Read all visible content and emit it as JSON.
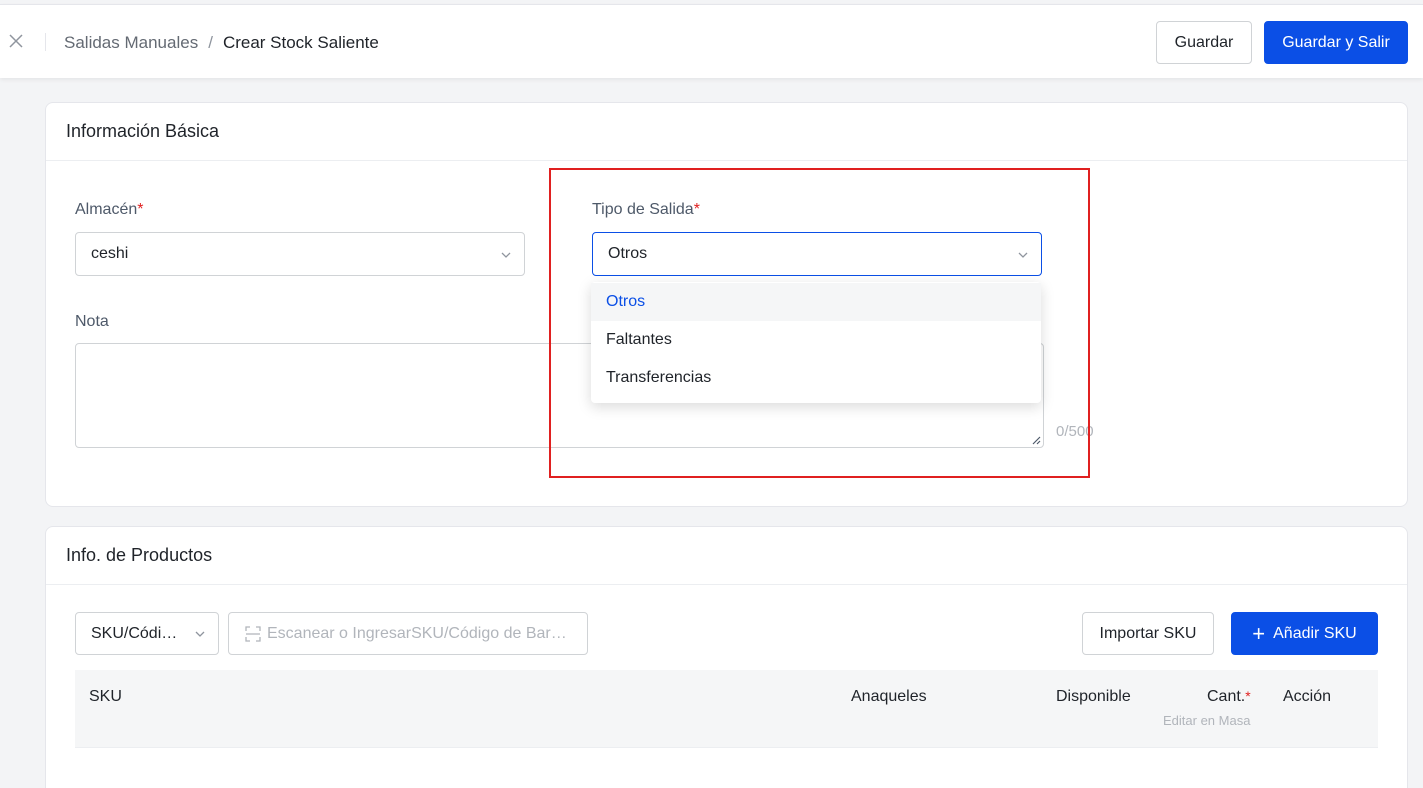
{
  "header": {
    "breadcrumb": {
      "parent": "Salidas Manuales",
      "separator": "/",
      "current": "Crear Stock Saliente"
    },
    "save_label": "Guardar",
    "save_exit_label": "Guardar y Salir"
  },
  "basic_info": {
    "title": "Información Básica",
    "warehouse": {
      "label": "Almacén",
      "required_mark": "*",
      "value": "ceshi"
    },
    "exit_type": {
      "label": "Tipo de Salida",
      "required_mark": "*",
      "value": "Otros",
      "options": [
        "Otros",
        "Faltantes",
        "Transferencias"
      ]
    },
    "note": {
      "label": "Nota",
      "counter": "0/500"
    }
  },
  "products": {
    "title": "Info. de Productos",
    "search_type": "SKU/Códi…",
    "search_placeholder": "Escanear o IngresarSKU/Código de Barras",
    "import_label": "Importar SKU",
    "add_label": "Añadir SKU",
    "add_icon_glyph": "+",
    "table": {
      "columns": {
        "sku": "SKU",
        "shelves": "Anaqueles",
        "available": "Disponible",
        "qty": "Cant.",
        "qty_required": "*",
        "qty_sub": "Editar en Masa",
        "action": "Acción"
      }
    }
  },
  "colors": {
    "primary": "#0b4fe6",
    "required": "#e02020",
    "highlight": "#e02020"
  }
}
